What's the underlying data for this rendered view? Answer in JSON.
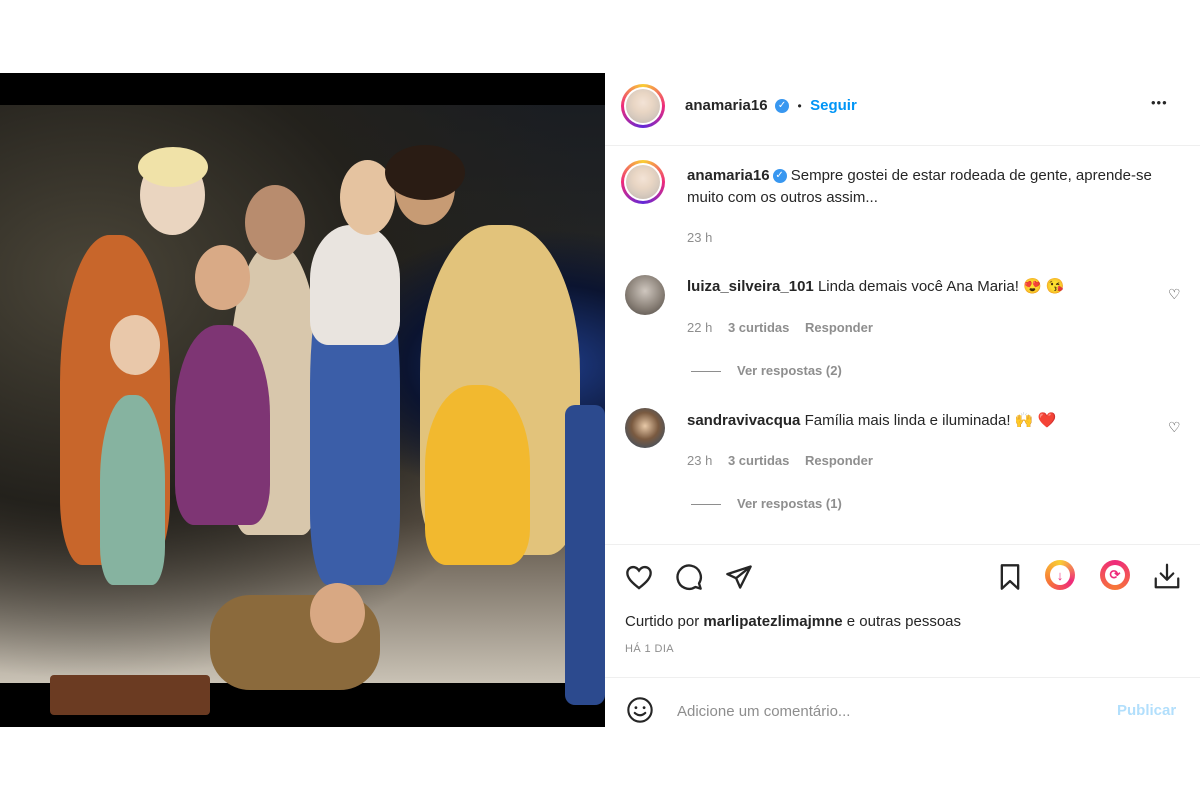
{
  "post": {
    "author": "anamaria16",
    "follow_label": "Seguir",
    "dot": "•",
    "more_label": "•••"
  },
  "caption": {
    "username": "anamaria16",
    "text": "Sempre gostei de estar rodeada de gente, aprende-se muito com os outros assim...",
    "time": "23 h"
  },
  "comments": [
    {
      "username": "luiza_silveira_101",
      "text": "Linda demais você Ana Maria! 😍 😘",
      "time": "22 h",
      "likes": "3 curtidas",
      "reply_label": "Responder",
      "view_replies": "Ver respostas (2)"
    },
    {
      "username": "sandravivacqua",
      "text": "Família mais linda e iluminada! 🙌 ❤️",
      "time": "23 h",
      "likes": "3 curtidas",
      "reply_label": "Responder",
      "view_replies": "Ver respostas (1)"
    }
  ],
  "likes": {
    "prefix": "Curtido por ",
    "user": "marlipatezlimajmne",
    "suffix": " e outras pessoas"
  },
  "date_label": "HÁ 1 DIA",
  "comment_box": {
    "placeholder": "Adicione um comentário...",
    "publish_label": "Publicar"
  },
  "icons": [
    "heart-icon",
    "comment-icon",
    "share-icon",
    "bookmark-icon",
    "download-icon",
    "sync-icon",
    "save-download-icon",
    "emoji-icon"
  ],
  "colors": {
    "accent": "#0095f6",
    "verified": "#3897f0",
    "muted": "#8e8e8e"
  }
}
